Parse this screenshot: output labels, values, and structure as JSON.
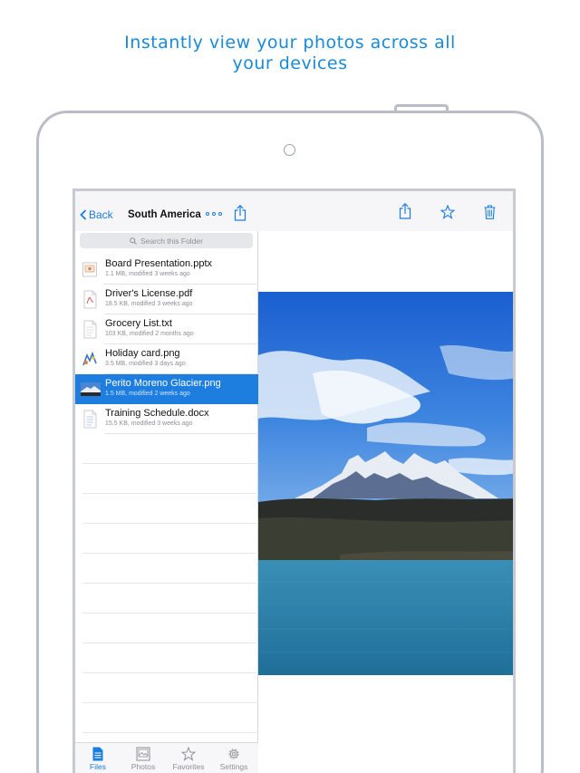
{
  "headline": {
    "line1": "Instantly view your photos across all",
    "line2": "your devices"
  },
  "navbar": {
    "back_label": "Back",
    "folder_title": "South America"
  },
  "search": {
    "placeholder": "Search this Folder"
  },
  "files": [
    {
      "name": "Board Presentation.pptx",
      "meta": "1.1 MB, modified 3 weeks ago",
      "icon": "pptx-file-icon"
    },
    {
      "name": "Driver's License.pdf",
      "meta": "18.5 KB, modified 3 weeks ago",
      "icon": "pdf-file-icon"
    },
    {
      "name": "Grocery List.txt",
      "meta": "103 KB, modified 2 months ago",
      "icon": "txt-file-icon"
    },
    {
      "name": "Holiday card.png",
      "meta": "3.5 MB, modified 3 days ago",
      "icon": "image-thumbnail-icon"
    },
    {
      "name": "Perito Moreno Glacier.png",
      "meta": "1.5 MB, modified 2 weeks ago",
      "icon": "image-thumbnail-icon",
      "selected": true
    },
    {
      "name": "Training Schedule.docx",
      "meta": "15.5 KB, modified 3 weeks ago",
      "icon": "docx-file-icon"
    }
  ],
  "tabs": [
    {
      "label": "Files",
      "icon": "files-icon",
      "active": true
    },
    {
      "label": "Photos",
      "icon": "photos-icon"
    },
    {
      "label": "Favorites",
      "icon": "star-icon"
    },
    {
      "label": "Settings",
      "icon": "gear-icon"
    }
  ],
  "colors": {
    "accent": "#1a7de0",
    "headline": "#1a8ad8",
    "selected_row": "#1e7ee0"
  }
}
